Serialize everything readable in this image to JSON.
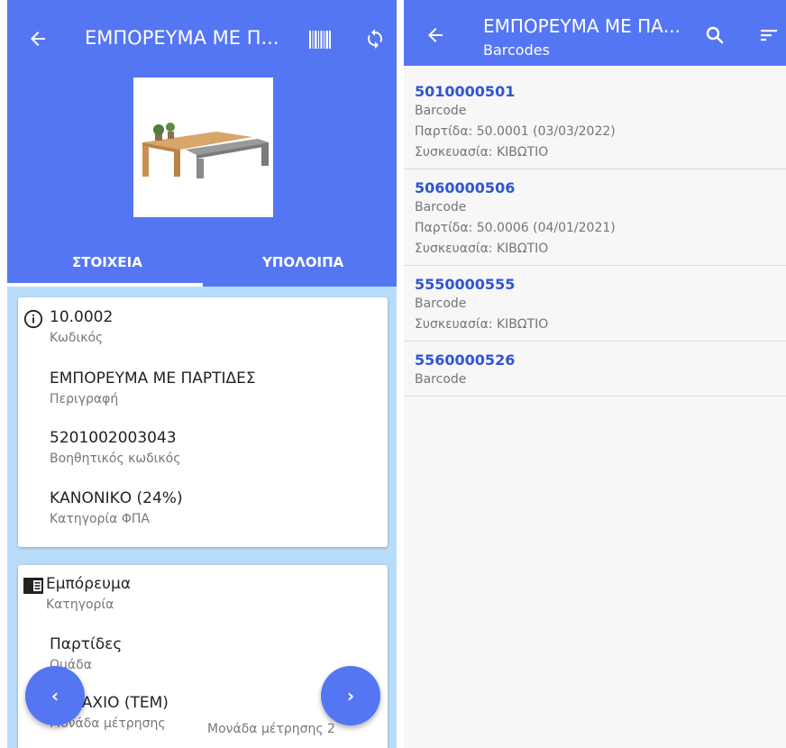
{
  "left": {
    "title": "ΕΜΠΟΡΕΥΜΑ ΜΕ Π...",
    "tabs": {
      "details": "ΣΤΟΙΧΕΙΑ",
      "balances": "ΥΠΟΛΟΙΠΑ"
    },
    "card1": [
      {
        "value": "10.0002",
        "label": "Κωδικός"
      },
      {
        "value": "ΕΜΠΟΡΕΥΜΑ ΜΕ ΠΑΡΤΙΔΕΣ",
        "label": "Περιγραφή"
      },
      {
        "value": "5201002003043",
        "label": "Βοηθητικός κωδικός"
      },
      {
        "value": "ΚΑΝΟΝΙΚΟ (24%)",
        "label": "Κατηγορία ΦΠΑ"
      }
    ],
    "card2": [
      {
        "value": "Εμπόρευμα",
        "label": "Κατηγορία"
      },
      {
        "value": "Παρτίδες",
        "label": "Ομάδα"
      },
      {
        "value": "ΤΕΜΑΧΙΟ (ΤΕΜ)",
        "label": "Μονάδα μέτρησης",
        "label2": "Μονάδα μέτρησης 2"
      }
    ],
    "fab_prev": "‹",
    "fab_next": "›"
  },
  "right": {
    "title": "ΕΜΠΟΡΕΥΜΑ ΜΕ ΠΑ...",
    "subtitle": "Barcodes",
    "items": [
      {
        "code": "5010000501",
        "type": "Barcode",
        "lot": "Παρτίδα:  50.0001 (03/03/2022)",
        "package": "Συσκευασία:  ΚΙΒΩΤΙΟ"
      },
      {
        "code": "5060000506",
        "type": "Barcode",
        "lot": "Παρτίδα:  50.0006 (04/01/2021)",
        "package": "Συσκευασία:  ΚΙΒΩΤΙΟ"
      },
      {
        "code": "5550000555",
        "type": "Barcode",
        "package": "Συσκευασία:  ΚΙΒΩΤΙΟ"
      },
      {
        "code": "5560000526",
        "type": "Barcode"
      }
    ]
  },
  "colors": {
    "primary": "#5576f3",
    "background": "#b9dcf9",
    "link": "#2f55d4"
  },
  "icons": [
    "back-arrow-icon",
    "barcode-icon",
    "sync-icon",
    "info-icon",
    "category-icon",
    "search-icon",
    "sort-icon"
  ]
}
